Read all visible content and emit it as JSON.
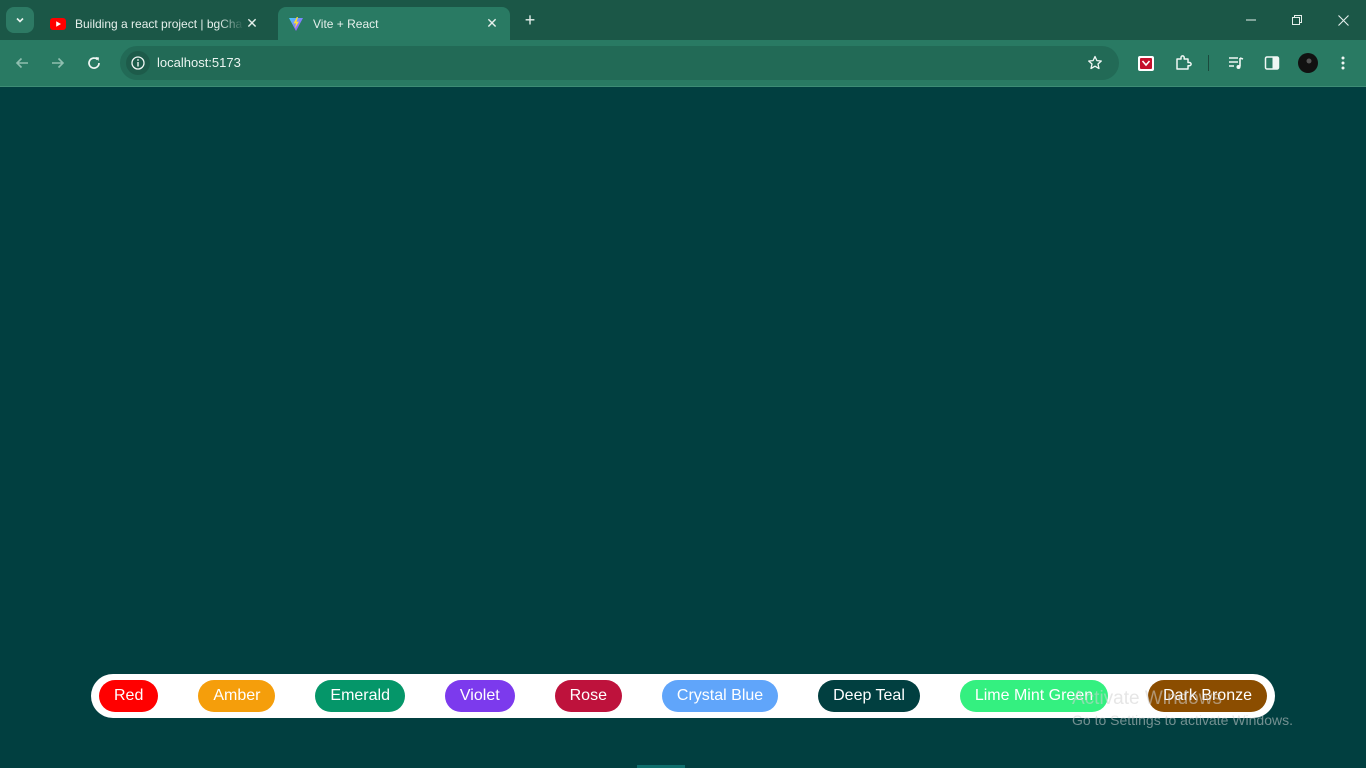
{
  "browser": {
    "tabs": [
      {
        "title": "Building a react project | bgCha",
        "active": false,
        "favicon": "youtube-icon"
      },
      {
        "title": "Vite + React",
        "active": true,
        "favicon": "vite-icon"
      }
    ],
    "address_bar": {
      "url": "localhost:5173"
    },
    "theme_color": "#297a63"
  },
  "page": {
    "background_color": "#013f40",
    "color_buttons": [
      {
        "label": "Red",
        "color": "#ff0000"
      },
      {
        "label": "Amber",
        "color": "#f59e0b"
      },
      {
        "label": "Emerald",
        "color": "#059669"
      },
      {
        "label": "Violet",
        "color": "#7c3aed"
      },
      {
        "label": "Rose",
        "color": "#be123c"
      },
      {
        "label": "Crystal Blue",
        "color": "#60a5fa"
      },
      {
        "label": "Deep Teal",
        "color": "#013f40"
      },
      {
        "label": "Lime Mint Green",
        "color": "#34f080"
      },
      {
        "label": "Dark Bronze",
        "color": "#8b4d00"
      }
    ]
  },
  "watermark": {
    "title": "Activate Windows",
    "subtitle": "Go to Settings to activate Windows."
  }
}
